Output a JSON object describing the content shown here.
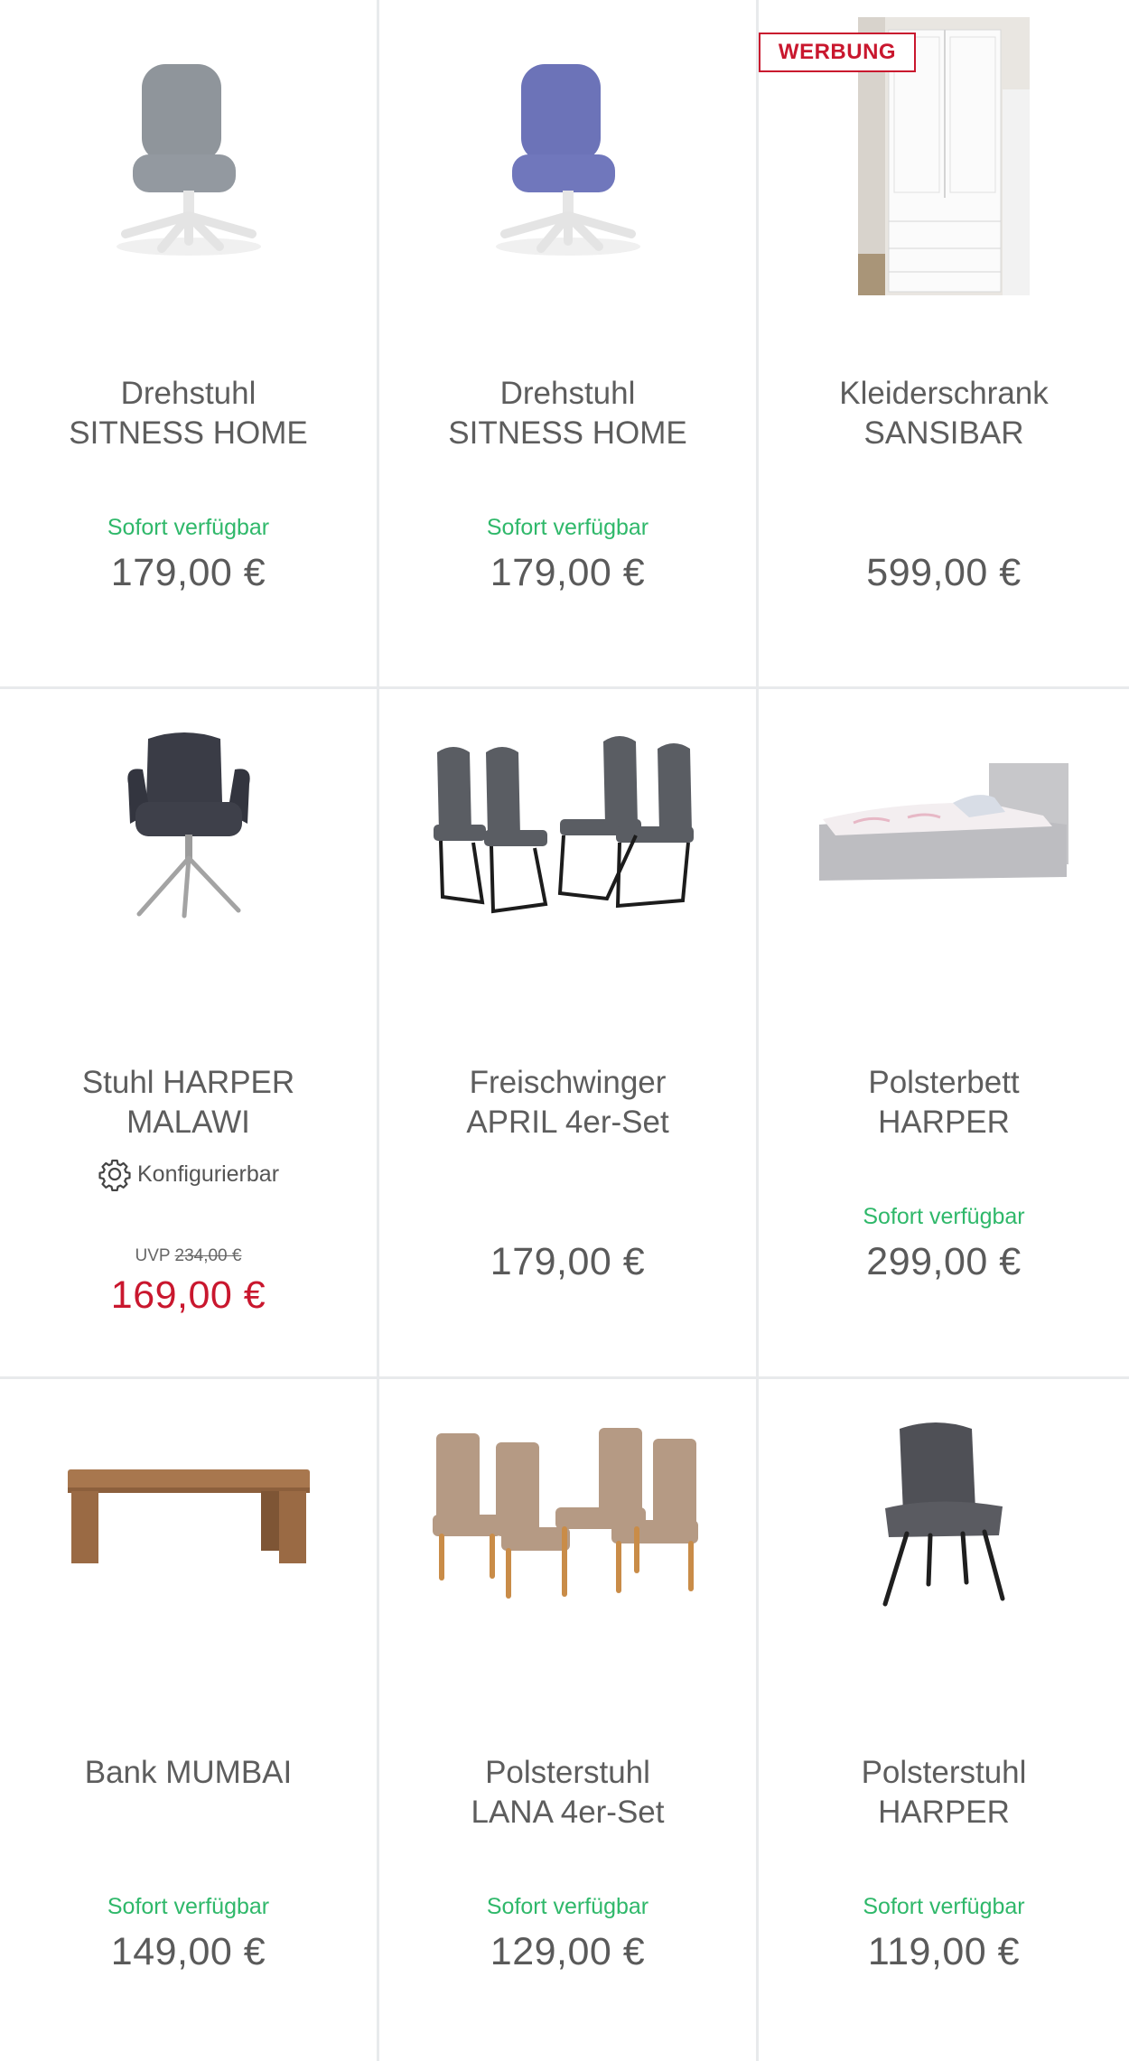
{
  "products": [
    {
      "title": "Drehstuhl\nSITNESS HOME",
      "availability": "Sofort verfügbar",
      "price": "179,00 €",
      "image": "office-chair-grey"
    },
    {
      "title": "Drehstuhl\nSITNESS HOME",
      "availability": "Sofort verfügbar",
      "price": "179,00 €",
      "image": "office-chair-blue"
    },
    {
      "title": "Kleiderschrank\nSANSIBAR",
      "badge": "WERBUNG",
      "price": "599,00 €",
      "image": "wardrobe-white"
    },
    {
      "title": "Stuhl HARPER\nMALAWI",
      "configurable": "Konfigurierbar",
      "uvp_label": "UVP",
      "uvp_price": "234,00 €",
      "price": "169,00 €",
      "image": "armchair-dark"
    },
    {
      "title": "Freischwinger\nAPRIL 4er-Set",
      "price": "179,00 €",
      "image": "cantilever-chairs-grey"
    },
    {
      "title": "Polsterbett\nHARPER",
      "availability": "Sofort verfügbar",
      "price": "299,00 €",
      "image": "upholstered-bed"
    },
    {
      "title": "Bank MUMBAI",
      "availability": "Sofort verfügbar",
      "price": "149,00 €",
      "image": "wooden-bench"
    },
    {
      "title": "Polsterstuhl\nLANA 4er-Set",
      "availability": "Sofort verfügbar",
      "price": "129,00 €",
      "image": "beige-chairs"
    },
    {
      "title": "Polsterstuhl\nHARPER",
      "availability": "Sofort verfügbar",
      "price": "119,00 €",
      "image": "grey-chair"
    }
  ],
  "colors": {
    "availability": "#2fb86a",
    "sale": "#c9172e",
    "text": "#5b5b5b",
    "divider": "#e8eaec"
  }
}
